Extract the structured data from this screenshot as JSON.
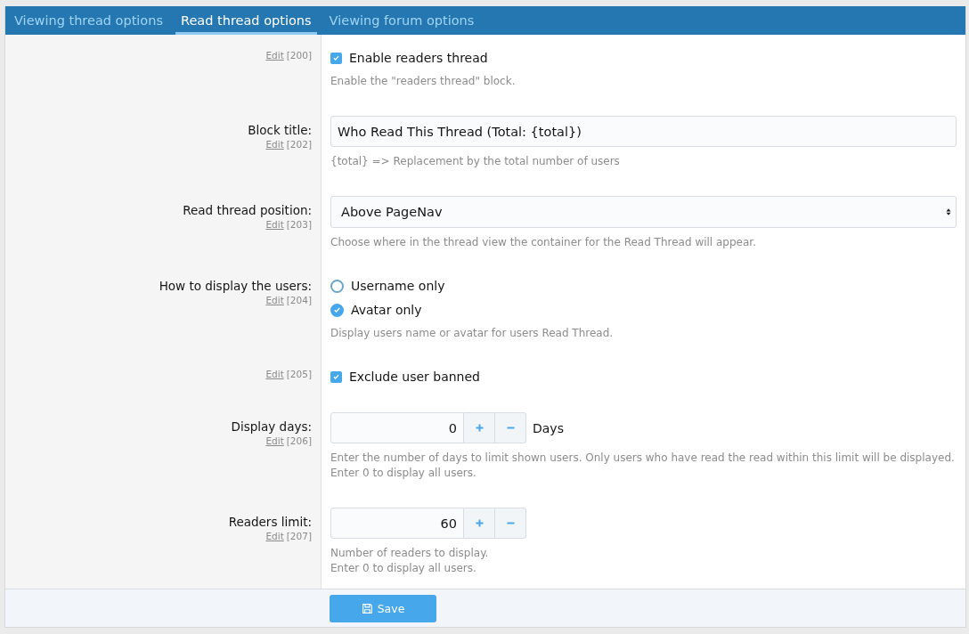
{
  "tabs": [
    {
      "label": "Viewing thread options",
      "selected": false
    },
    {
      "label": "Read thread options",
      "selected": true
    },
    {
      "label": "Viewing forum options",
      "selected": false
    }
  ],
  "options": [
    {
      "kind": "checkbox",
      "edit": "Edit",
      "id_text": "[200]",
      "choices": [
        {
          "label": "Enable readers thread",
          "checked": true
        }
      ],
      "hint": [
        "Enable the \"readers thread\" block."
      ]
    },
    {
      "kind": "text",
      "label": "Block title:",
      "edit": "Edit",
      "id_text": "[202]",
      "value": "Who Read This Thread (Total: {total})",
      "hint": [
        "{total} => Replacement by the total number of users"
      ]
    },
    {
      "kind": "select",
      "label": "Read thread position:",
      "edit": "Edit",
      "id_text": "[203]",
      "value": "Above PageNav",
      "hint": [
        "Choose where in the thread view the container for the Read Thread will appear."
      ]
    },
    {
      "kind": "radio",
      "label": "How to display the users:",
      "edit": "Edit",
      "id_text": "[204]",
      "choices": [
        {
          "label": "Username only",
          "selected": false
        },
        {
          "label": "Avatar only",
          "selected": true
        }
      ],
      "hint": [
        "Display users name or avatar for users Read Thread."
      ]
    },
    {
      "kind": "checkbox",
      "edit": "Edit",
      "id_text": "[205]",
      "choices": [
        {
          "label": "Exclude user banned",
          "checked": true
        }
      ]
    },
    {
      "kind": "number",
      "label": "Display days:",
      "edit": "Edit",
      "id_text": "[206]",
      "value": "0",
      "units": "Days",
      "hint": [
        "Enter the number of days to limit shown users. Only users who have read the read within this limit will be displayed.",
        "Enter 0 to display all users."
      ]
    },
    {
      "kind": "number",
      "label": "Readers limit:",
      "edit": "Edit",
      "id_text": "[207]",
      "value": "60",
      "hint": [
        "Number of readers to display.",
        "Enter 0 to display all users."
      ]
    }
  ],
  "save_button": "Save"
}
